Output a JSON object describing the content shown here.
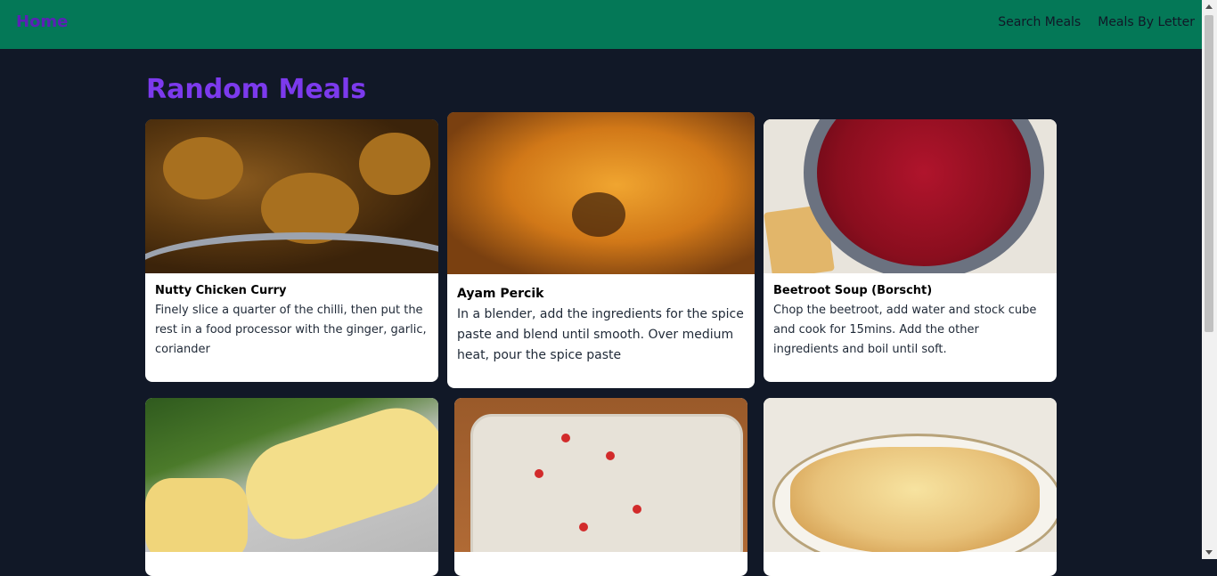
{
  "nav": {
    "home_label": "Home",
    "links": [
      "Search Meals",
      "Meals By Letter"
    ]
  },
  "page": {
    "title": "Random Meals"
  },
  "meals": [
    {
      "title": "Nutty Chicken Curry",
      "description": "Finely slice a quarter of the chilli, then put the rest in a food processor with the ginger, garlic, coriander"
    },
    {
      "title": "Ayam Percik",
      "description": "In a blender, add the ingredients for the spice paste and blend until smooth. Over medium heat, pour the spice paste"
    },
    {
      "title": "Beetroot Soup (Borscht)",
      "description": "Chop the beetroot, add water and stock cube and cook for 15mins. Add the other ingredients and boil until soft."
    },
    {
      "title": "",
      "description": ""
    },
    {
      "title": "",
      "description": ""
    },
    {
      "title": "",
      "description": ""
    }
  ],
  "colors": {
    "navbar_bg": "#047857",
    "page_bg": "#111827",
    "accent": "#7c3aed"
  }
}
